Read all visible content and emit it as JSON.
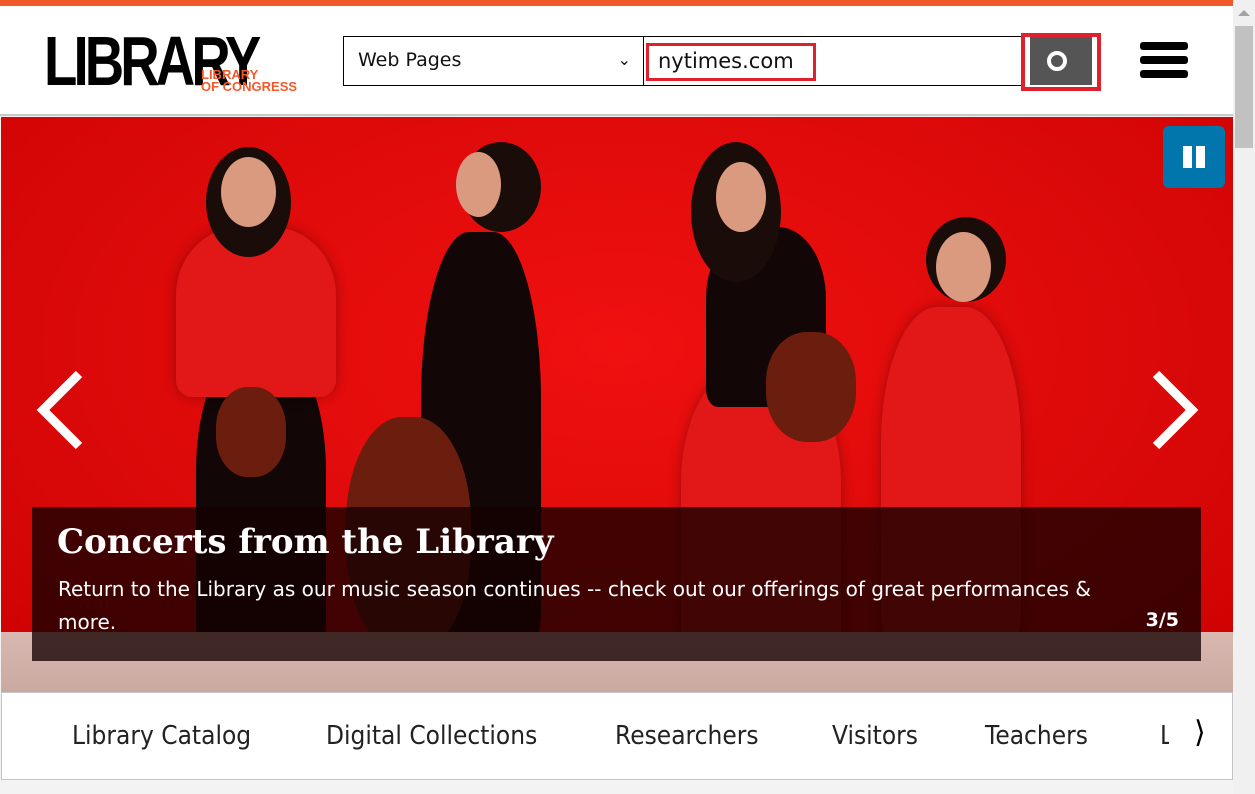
{
  "logo": {
    "main": "LIBRARY",
    "sub_line1": "LIBRARY",
    "sub_line2": "OF CONGRESS"
  },
  "search": {
    "scope": "Web Pages",
    "query": "nytimes.com",
    "icon": "search-icon"
  },
  "menu": {
    "icon": "hamburger-icon"
  },
  "carousel": {
    "title": "Concerts from the Library",
    "description": "Return to the Library as our music season continues -- check out our offerings of great performances & more.",
    "counter": "3/5"
  },
  "nav": {
    "items": [
      "Library Catalog",
      "Digital Collections",
      "Researchers",
      "Visitors",
      "Teachers",
      "L"
    ]
  },
  "colors": {
    "brand_orange": "#f05a2b",
    "pause_blue": "#0076ad",
    "highlight_red": "#e0202a"
  }
}
